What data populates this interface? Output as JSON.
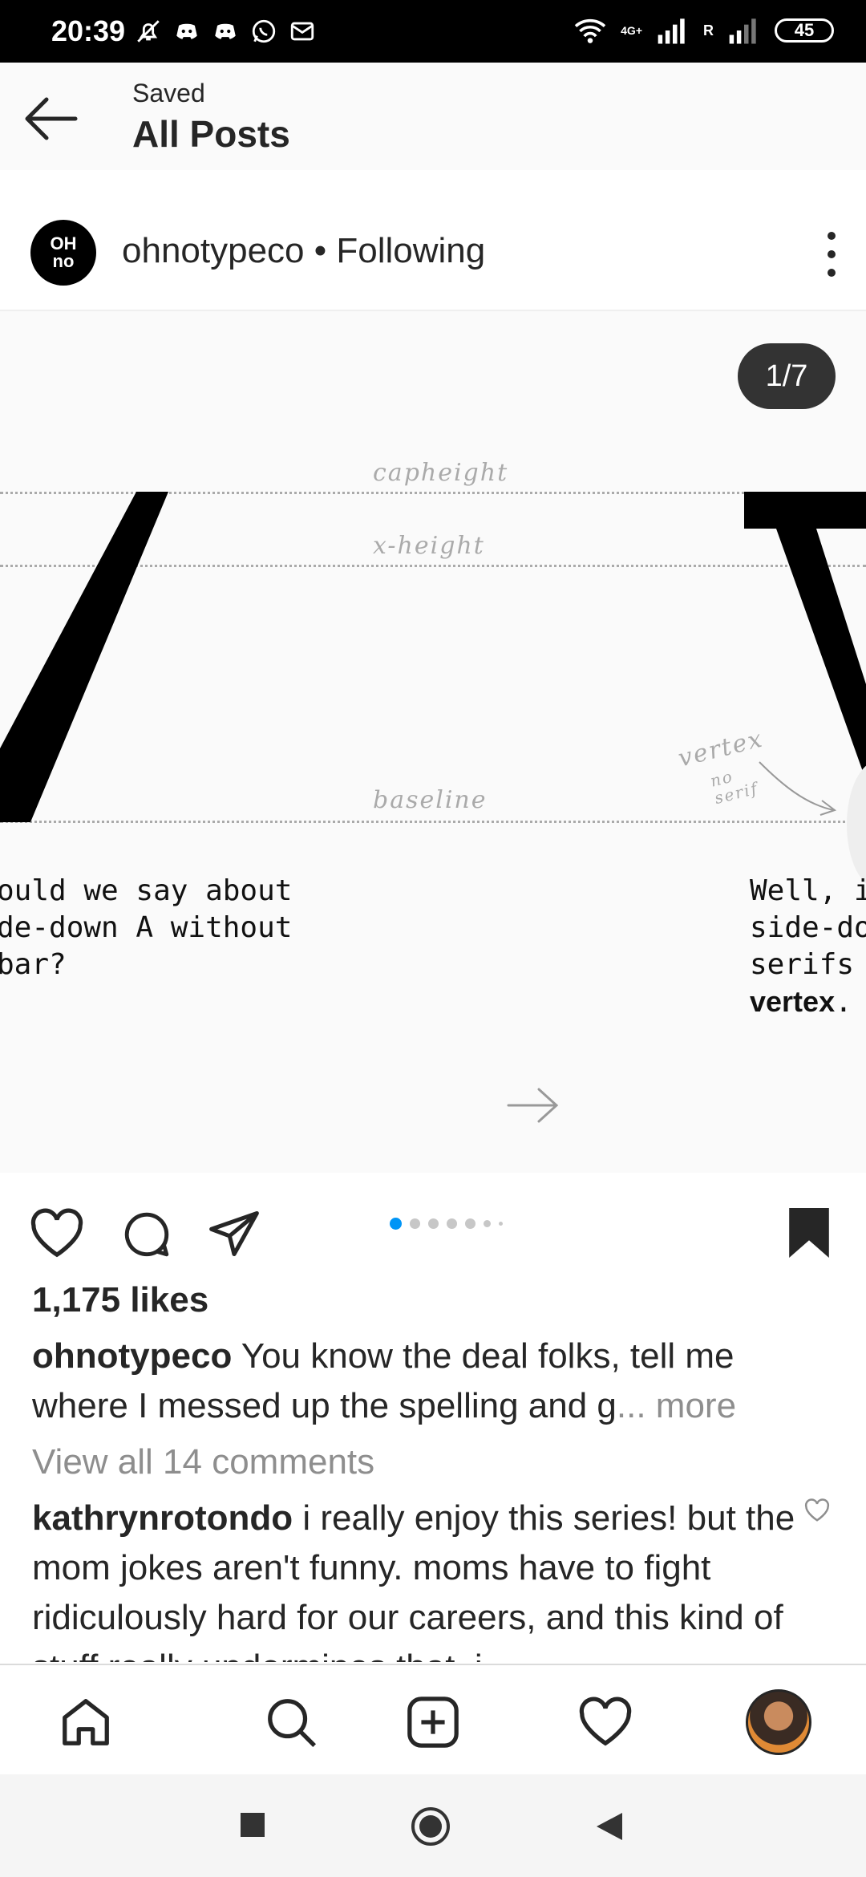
{
  "status": {
    "time": "20:39",
    "network_label": "4G+",
    "roaming_label": "R",
    "battery": "45"
  },
  "appbar": {
    "subtitle": "Saved",
    "title": "All Posts"
  },
  "post": {
    "username": "ohnotypeco",
    "separator": " • ",
    "follow_state": "Following",
    "avatar_text_1": "OH",
    "avatar_text_2": "no",
    "carousel_counter": "1/7",
    "slide": {
      "guides": {
        "capheight": "capheight",
        "xheight": "x-height",
        "baseline": "baseline"
      },
      "annotation_vertex": "vertex",
      "annotation_noserif": "no\nserif",
      "text_left": [
        "ould we say about",
        "de-down A without",
        "bar?"
      ],
      "text_right": [
        "Well, it's",
        "side-do",
        "serifs o"
      ],
      "text_right_bold": "vertex",
      "text_right_tail": "."
    },
    "carousel_position": 1,
    "carousel_total": 7,
    "likes": "1,175 likes",
    "caption_user": "ohnotypeco",
    "caption_text": " You know the deal folks, tell me where I messed up the spelling and g",
    "caption_more": "... more",
    "view_all": "View all 14 comments",
    "comment_user": "kathrynrotondo",
    "comment_text": " i really enjoy this series! but the mom jokes aren't funny. moms have to fight ridiculously hard for our careers, and this kind of stuff really undermines that. i"
  },
  "icons": {
    "back": "arrow-left-icon",
    "more": "more-vertical-icon",
    "like": "heart-icon",
    "comment": "comment-icon",
    "share": "send-icon",
    "save": "bookmark-filled-icon",
    "home": "home-icon",
    "search": "search-icon",
    "add": "add-post-icon",
    "activity": "heart-icon",
    "profile": "profile-avatar"
  },
  "colors": {
    "accent": "#0095f6",
    "text": "#262626",
    "muted": "#8e8e8e",
    "counter_bg": "#333333"
  }
}
